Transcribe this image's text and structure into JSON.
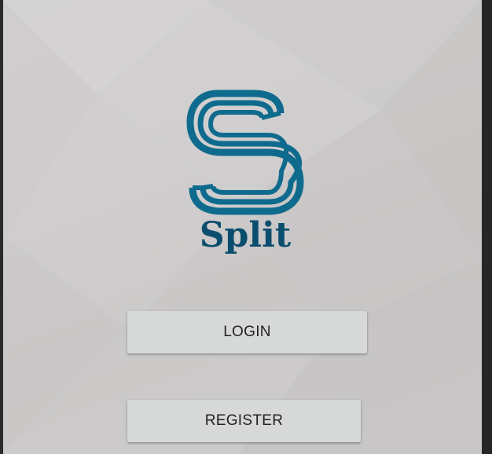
{
  "app": {
    "logo_text": "Split",
    "logo_icon": "split-s-logo-icon",
    "brand_color": "#0e6a8d",
    "wordmark_color": "#0b4d6e"
  },
  "buttons": {
    "login_label": "LOGIN",
    "register_label": "REGISTER"
  }
}
